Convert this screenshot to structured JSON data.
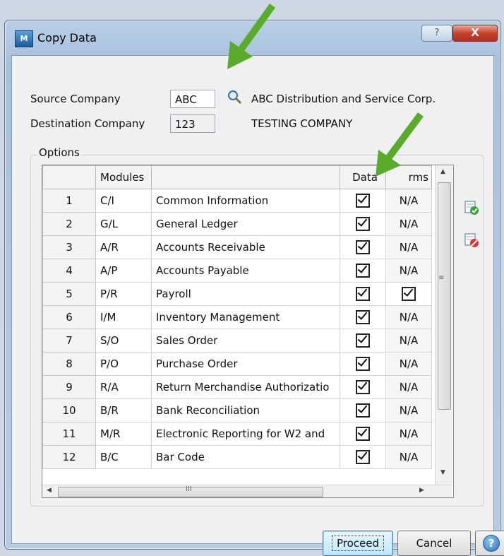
{
  "window": {
    "title": "Copy Data",
    "help_glyph": "?",
    "close_glyph": "X"
  },
  "source": {
    "label": "Source Company",
    "code": "ABC",
    "name": "ABC Distribution and Service Corp."
  },
  "destination": {
    "label": "Destination Company",
    "code": "123",
    "name": "TESTING COMPANY"
  },
  "options": {
    "label": "Options",
    "columns": [
      "Modules",
      "",
      "Data",
      "rms"
    ],
    "rows": [
      {
        "num": "1",
        "module": "C/I",
        "desc": "Common Information",
        "data": true,
        "forms": "N/A"
      },
      {
        "num": "2",
        "module": "G/L",
        "desc": "General Ledger",
        "data": true,
        "forms": "N/A"
      },
      {
        "num": "3",
        "module": "A/R",
        "desc": "Accounts Receivable",
        "data": true,
        "forms": "N/A"
      },
      {
        "num": "4",
        "module": "A/P",
        "desc": "Accounts Payable",
        "data": true,
        "forms": "N/A"
      },
      {
        "num": "5",
        "module": "P/R",
        "desc": "Payroll",
        "data": true,
        "forms": "checked"
      },
      {
        "num": "6",
        "module": "I/M",
        "desc": "Inventory Management",
        "data": true,
        "forms": "N/A"
      },
      {
        "num": "7",
        "module": "S/O",
        "desc": "Sales Order",
        "data": true,
        "forms": "N/A"
      },
      {
        "num": "8",
        "module": "P/O",
        "desc": "Purchase Order",
        "data": true,
        "forms": "N/A"
      },
      {
        "num": "9",
        "module": "R/A",
        "desc": "Return Merchandise Authorizatio",
        "data": true,
        "forms": "N/A"
      },
      {
        "num": "10",
        "module": "B/R",
        "desc": "Bank Reconciliation",
        "data": true,
        "forms": "N/A"
      },
      {
        "num": "11",
        "module": "M/R",
        "desc": "Electronic Reporting for W2 and",
        "data": true,
        "forms": "N/A"
      },
      {
        "num": "12",
        "module": "B/C",
        "desc": "Bar Code",
        "data": true,
        "forms": "N/A"
      }
    ]
  },
  "buttons": {
    "proceed": "Proceed",
    "cancel": "Cancel",
    "help": "?"
  },
  "icons": {
    "app": "sage-app-icon",
    "lookup": "magnifier-icon",
    "select_all": "select-all-icon",
    "clear_all": "clear-all-icon",
    "arrows": "green-annotation-arrow"
  },
  "colors": {
    "arrow": "#5aab2c",
    "close": "#c7432b",
    "default_button": "#3c7fb1"
  }
}
